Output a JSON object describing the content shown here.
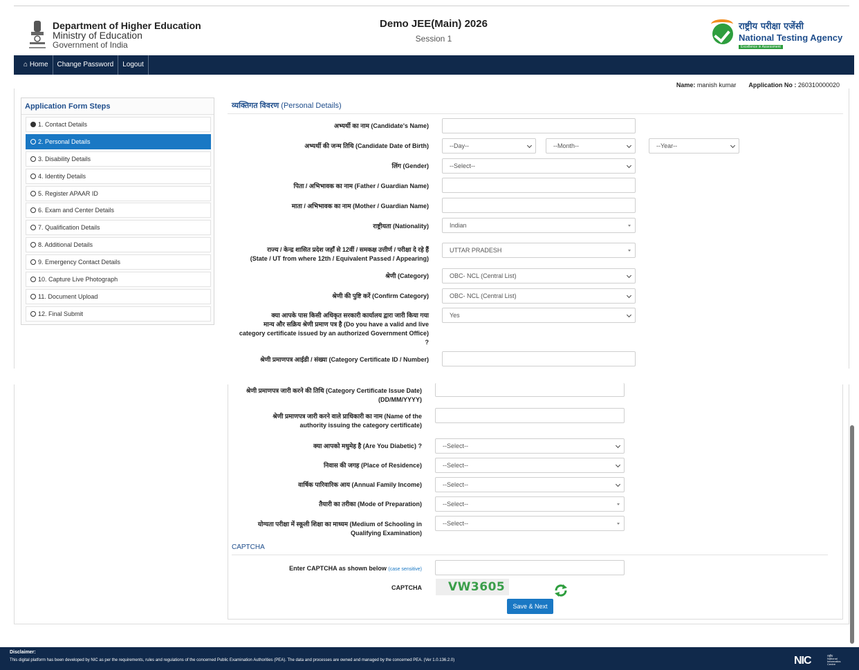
{
  "header": {
    "dept_line1": "Department of Higher Education",
    "dept_line2": "Ministry of Education",
    "dept_line3": "Government of India",
    "exam_title": "Demo JEE(Main) 2026",
    "session": "Session 1",
    "agency_hindi": "राष्ट्रीय परीक्षा एजेंसी",
    "agency_english": "National Testing Agency",
    "agency_tagline": "Excellence in Assessment"
  },
  "nav": {
    "home": "Home",
    "change_password": "Change Password",
    "logout": "Logout"
  },
  "user": {
    "name_label": "Name:",
    "name": "manish kumar",
    "app_label": "Application No :",
    "app_no": "260310000020"
  },
  "sidebar": {
    "title": "Application Form Steps",
    "steps": [
      {
        "label": "1. Contact Details"
      },
      {
        "label": "2. Personal Details"
      },
      {
        "label": "3. Disability Details"
      },
      {
        "label": "4. Identity Details"
      },
      {
        "label": "5. Register APAAR ID"
      },
      {
        "label": "6. Exam and Center Details"
      },
      {
        "label": "7. Qualification Details"
      },
      {
        "label": "8. Additional Details"
      },
      {
        "label": "9. Emergency Contact Details"
      },
      {
        "label": "10. Capture Live Photograph"
      },
      {
        "label": "11. Document Upload"
      },
      {
        "label": "12. Final Submit"
      }
    ]
  },
  "section": {
    "hindi": "व्यक्तिगत विवरण",
    "english": "(Personal Details)"
  },
  "form": {
    "candidate_name": "अभ्यर्थी का नाम (Candidate's Name)",
    "dob": "अभ्यर्थी की जन्म तिथि (Candidate Date of Birth)",
    "dob_day": "--Day--",
    "dob_month": "--Month--",
    "dob_year": "--Year--",
    "gender": "लिंग (Gender)",
    "gender_value": "--Select--",
    "father": "पिता / अभिभावक का नाम (Father / Guardian Name)",
    "mother": "माता / अभिभावक का नाम (Mother / Guardian Name)",
    "nationality": "राष्ट्रीयता (Nationality)",
    "nationality_value": "Indian",
    "state_line1": "राज्य / केन्द्र शासित प्रदेश जहाँ से 12वीं / समकक्ष उत्तीर्ण / परीक्षा दे रहे हैं",
    "state_line2": "(State / UT from where 12th / Equivalent Passed / Appearing)",
    "state_value": "UTTAR PRADESH",
    "category": "श्रेणी (Category)",
    "category_value": "OBC- NCL (Central List)",
    "confirm_category": "श्रेणी की पुष्टि करें (Confirm Category)",
    "confirm_category_value": "OBC- NCL (Central List)",
    "cert_q1": "क्या आपके पास किसी अधिकृत सरकारी कार्यालय द्वारा जारी किया गया",
    "cert_q2": "मान्य और सक्रिय श्रेणी प्रमाण पत्र है (Do you have a valid and live",
    "cert_q3": "category certificate issued by an authorized Government Office)",
    "cert_q4": "?",
    "cert_value": "Yes",
    "cert_id": "श्रेणी प्रमाणपत्र आईडी / संख्या (Category Certificate ID / Number)",
    "cert_date1": "श्रेणी प्रमाणपत्र जारी करने की तिथि (Category Certificate Issue Date)",
    "cert_date2": "(DD/MM/YYYY)",
    "authority1": "श्रेणी प्रमाणपत्र जारी करने वाले प्राधिकारी का नाम (Name of the",
    "authority2": "authority issuing the category certificate)",
    "diabetic": "क्या आपको मधुमेह है (Are You Diabetic) ?",
    "residence": "निवास की जगह (Place of Residence)",
    "income": "वार्षिक पारिवारिक आय (Annual Family Income)",
    "preparation": "तैयारी का तरीका (Mode of Preparation)",
    "medium1": "योग्यता परीक्षा में स्कूली शिक्षा का माध्यम (Medium of Schooling in",
    "medium2": "Qualifying Examination)",
    "select_placeholder": "--Select--"
  },
  "captcha": {
    "title": "CAPTCHA",
    "enter_label": "Enter CAPTCHA as shown below",
    "case_note": "(case sensitive)",
    "label": "CAPTCHA",
    "code": "VW3605"
  },
  "save_next": "Save & Next",
  "footer": {
    "disclaimer_title": "Disclaimer:",
    "disclaimer_text": "This digital platform has been developed by NIC as per the requirements, rules and regulations of the concerned Public Examination Authorities (PEA). The data and processes are owned and managed by the concerned PEA. (Ver 1.0.136.2.0)",
    "nic": "NIC",
    "nic_sub_hi": "राष्ट्रीय",
    "nic_sub1": "National",
    "nic_sub2": "Informatics",
    "nic_sub3": "Centre"
  },
  "colors": {
    "navy": "#10294b",
    "accent_blue": "#1a78c4",
    "title_blue": "#1f4e8c",
    "green": "#2e9e3e"
  }
}
